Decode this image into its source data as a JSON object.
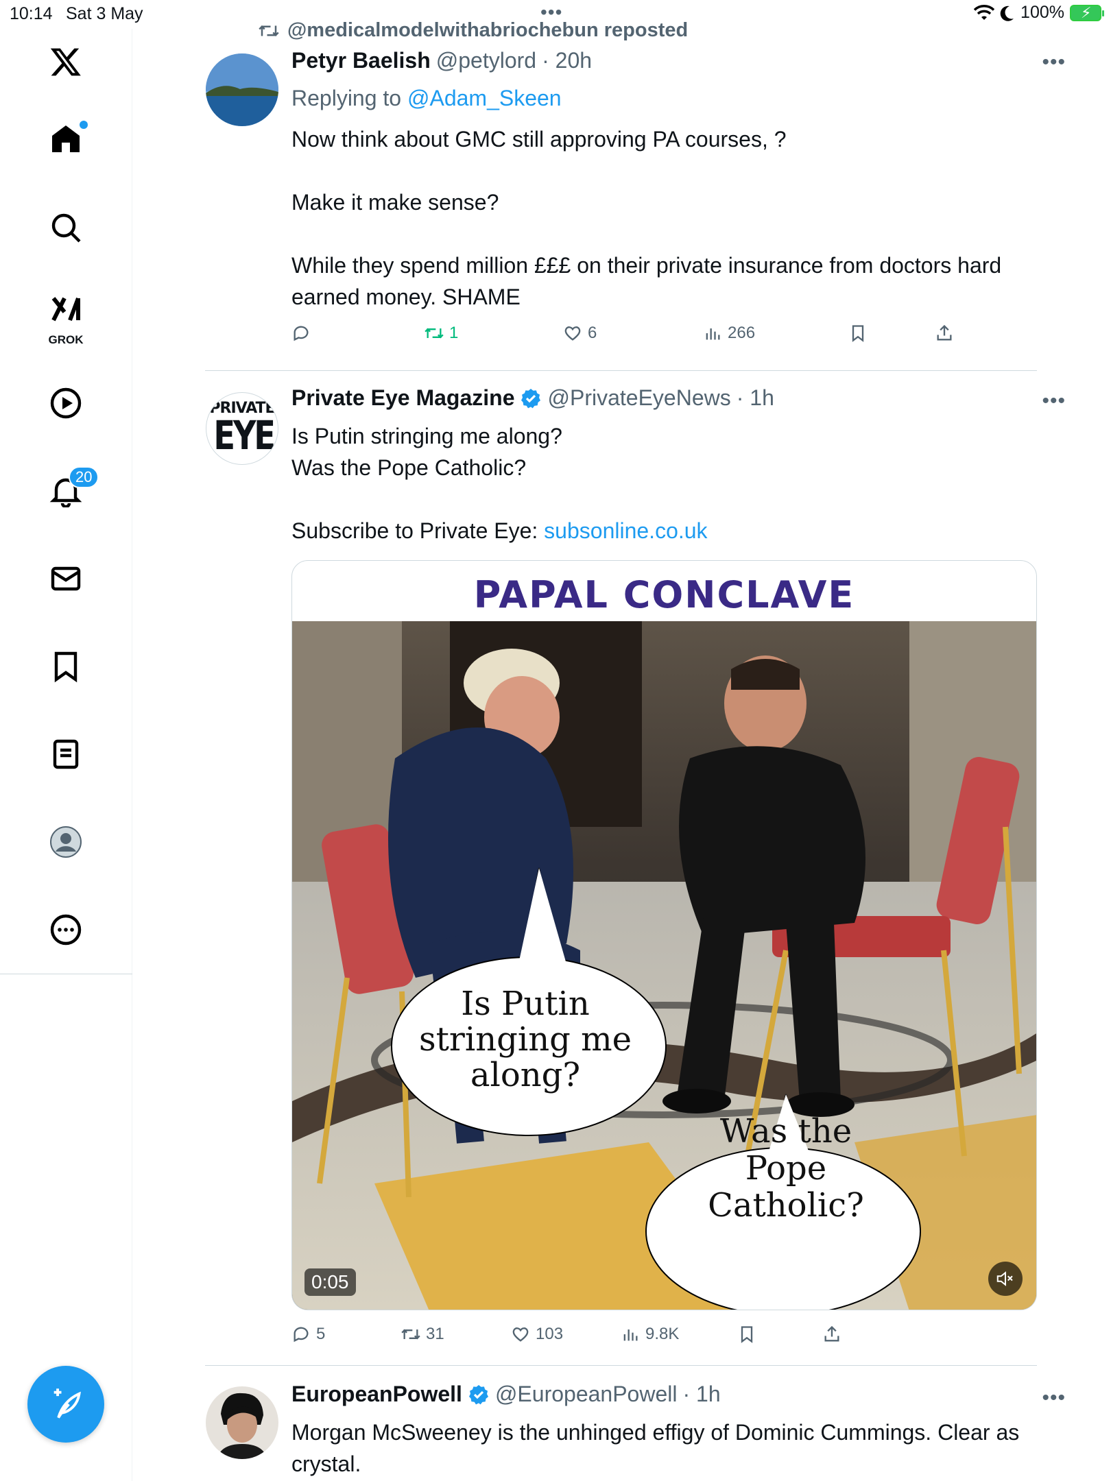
{
  "status_bar": {
    "time": "10:14",
    "date": "Sat 3 May",
    "battery": "100%"
  },
  "sidebar": {
    "grok_label": "GROK",
    "notifications_badge": "20"
  },
  "repost": {
    "text": "@medicalmodelwithabriochebun reposted"
  },
  "tweets": [
    {
      "name": "Petyr Baelish",
      "handle": "@petylord",
      "time": "· 20h",
      "replying_prefix": "Replying to ",
      "replying_to": "@Adam_Skeen",
      "text": "Now think about GMC still approving PA courses, ?\n\nMake it make sense?\n\nWhile they spend million £££ on their private insurance from doctors hard earned money. SHAME",
      "reposts": "1",
      "likes": "6",
      "views": "266"
    },
    {
      "name": "Private Eye Magazine",
      "handle": "@PrivateEyeNews",
      "time": "· 1h",
      "text": "Is Putin stringing me along?\nWas the Pope Catholic?\n\nSubscribe to Private Eye: ",
      "link": "subsonline.co.uk",
      "avatar_text_top": "PRIVATE",
      "avatar_text_bottom": "EYE",
      "media": {
        "title": "PAPAL CONCLAVE",
        "bubble_left": [
          "Is Putin",
          "stringing me",
          "along?"
        ],
        "bubble_right": [
          "Was the",
          "Pope",
          "Catholic?"
        ],
        "timer": "0:05"
      },
      "replies": "5",
      "reposts": "31",
      "likes": "103",
      "views": "9.8K"
    },
    {
      "name": "EuropeanPowell",
      "handle": "@EuropeanPowell",
      "time": "· 1h",
      "text": "Morgan McSweeney is the unhinged effigy of Dominic Cummings. Clear as crystal."
    }
  ],
  "colors": {
    "accent": "#1d9bf0",
    "repost_green": "#00ba7c",
    "muted": "#536471",
    "title_purple": "#3a2a86"
  }
}
